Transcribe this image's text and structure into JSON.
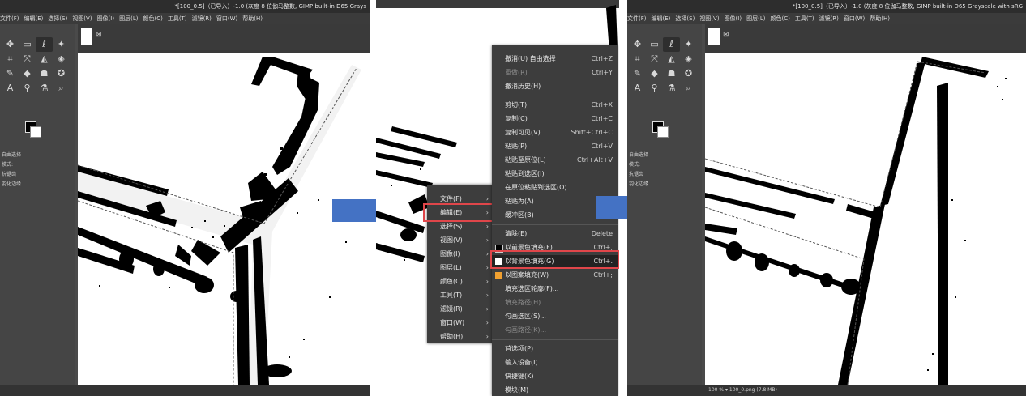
{
  "colors": {
    "arrow": "#4472c4",
    "highlight": "#e0464a",
    "fg_swatch": "#000000",
    "bg_swatch": "#ffffff",
    "pattern_swatch": "#f0a030"
  },
  "left": {
    "title": "*[100_0.5]（已导入）-1.0 (灰度 8 位伽马整数, GIMP built-in D65 Grays",
    "menubar": [
      "文件(F)",
      "编辑(E)",
      "选择(S)",
      "视图(V)",
      "图像(I)",
      "图层(L)",
      "颜色(C)",
      "工具(T)",
      "滤镜(R)",
      "窗口(W)",
      "帮助(H)"
    ],
    "tool_options_title": "自由选择",
    "mode_label": "模式:",
    "antialias_label": "抗锯齿",
    "feather_label": "羽化边缘"
  },
  "right": {
    "title": "*[100_0.5]（已导入）-1.0 (灰度 8 位伽马整数, GIMP built-in D65 Grayscale with sRG",
    "menubar": [
      "文件(F)",
      "编辑(E)",
      "选择(S)",
      "视图(V)",
      "图像(I)",
      "图层(L)",
      "颜色(C)",
      "工具(T)",
      "滤镜(R)",
      "窗口(W)",
      "帮助(H)"
    ],
    "tool_options_title": "自由选择",
    "mode_label": "模式:",
    "antialias_label": "抗锯齿",
    "feather_label": "羽化边缘",
    "status": "100 % ▾  100_0.png (7.8 MB)"
  },
  "main_menu": {
    "items": [
      "文件(F)",
      "编辑(E)",
      "选择(S)",
      "视图(V)",
      "图像(I)",
      "图层(L)",
      "颜色(C)",
      "工具(T)",
      "滤镜(R)",
      "窗口(W)",
      "帮助(H)"
    ]
  },
  "edit_menu": {
    "items": [
      {
        "label": "撤消(U) 自由选择",
        "shortcut": "Ctrl+Z",
        "disabled": false
      },
      {
        "label": "重做(R)",
        "shortcut": "Ctrl+Y",
        "disabled": true
      },
      {
        "label": "撤消历史(H)",
        "shortcut": "",
        "disabled": false
      },
      {
        "label": "剪切(T)",
        "shortcut": "Ctrl+X",
        "disabled": false
      },
      {
        "label": "复制(C)",
        "shortcut": "Ctrl+C",
        "disabled": false
      },
      {
        "label": "复制可见(V)",
        "shortcut": "Shift+Ctrl+C",
        "disabled": false
      },
      {
        "label": "粘贴(P)",
        "shortcut": "Ctrl+V",
        "disabled": false
      },
      {
        "label": "粘贴至原位(L)",
        "shortcut": "Ctrl+Alt+V",
        "disabled": false
      },
      {
        "label": "粘贴到选区(I)",
        "shortcut": "",
        "disabled": false
      },
      {
        "label": "在原位粘贴到选区(O)",
        "shortcut": "",
        "disabled": false
      },
      {
        "label": "粘贴为(A)",
        "shortcut": "",
        "disabled": false
      },
      {
        "label": "缓冲区(B)",
        "shortcut": "",
        "disabled": false
      },
      {
        "label": "清除(E)",
        "shortcut": "Delete",
        "disabled": false
      },
      {
        "label": "以前景色填充(F)",
        "shortcut": "Ctrl+,",
        "disabled": false
      },
      {
        "label": "以背景色填充(G)",
        "shortcut": "Ctrl+.",
        "disabled": false
      },
      {
        "label": "以图案填充(W)",
        "shortcut": "Ctrl+;",
        "disabled": false
      },
      {
        "label": "填充选区轮廓(F)...",
        "shortcut": "",
        "disabled": false
      },
      {
        "label": "填充路径(H)...",
        "shortcut": "",
        "disabled": true
      },
      {
        "label": "勾画选区(S)...",
        "shortcut": "",
        "disabled": false
      },
      {
        "label": "勾画路径(K)...",
        "shortcut": "",
        "disabled": true
      },
      {
        "label": "首选项(P)",
        "shortcut": "",
        "disabled": false
      },
      {
        "label": "输入设备(I)",
        "shortcut": "",
        "disabled": false
      },
      {
        "label": "快捷键(K)",
        "shortcut": "",
        "disabled": false
      },
      {
        "label": "模块(M)",
        "shortcut": "",
        "disabled": false
      }
    ]
  },
  "icons": [
    "move-icon",
    "rect-select-icon",
    "lasso-icon",
    "fuzzy-select-icon",
    "crop-icon",
    "transform-icon",
    "warp-icon",
    "bucket-fill-icon",
    "paintbrush-icon",
    "eraser-icon",
    "smudge-icon",
    "text-icon",
    "color-picker-icon",
    "zoom-icon",
    "arrow-right-icon",
    "submenu-chevron-icon"
  ]
}
